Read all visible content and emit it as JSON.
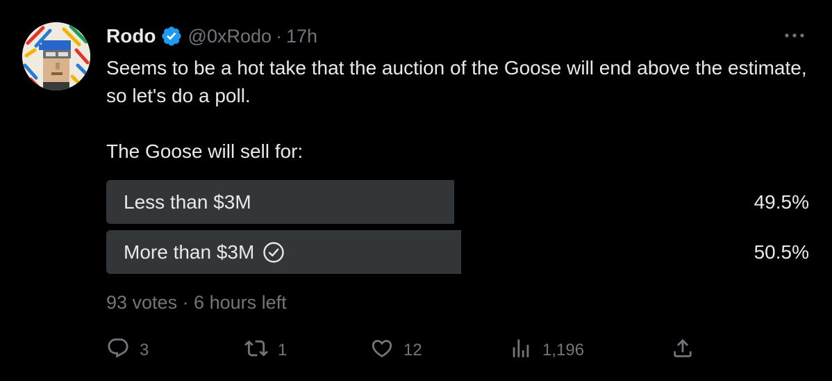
{
  "author": {
    "name": "Rodo",
    "handle": "@0xRodo",
    "separator": "·",
    "time": "17h"
  },
  "tweet": {
    "text_line1": "Seems to be a hot take that the auction of the Goose will end above the estimate, so let's do a poll.",
    "text_line2": "The Goose will sell for:"
  },
  "poll": {
    "options": [
      {
        "label": "Less than $3M",
        "percent": "49.5%",
        "fraction": 0.495,
        "winner": false
      },
      {
        "label": "More than $3M",
        "percent": "50.5%",
        "fraction": 0.505,
        "winner": true
      }
    ],
    "meta": "93 votes · 6 hours left"
  },
  "actions": {
    "replies": "3",
    "reposts": "1",
    "likes": "12",
    "views": "1,196"
  },
  "colors": {
    "background": "#000000",
    "text": "#e7e9ea",
    "muted": "#71767b",
    "poll_bar": "#333639",
    "verified": "#1d9bf0"
  },
  "icons": [
    "verified-badge-icon",
    "more-icon",
    "check-circle-icon",
    "reply-icon",
    "repost-icon",
    "like-icon",
    "views-icon",
    "share-icon"
  ]
}
